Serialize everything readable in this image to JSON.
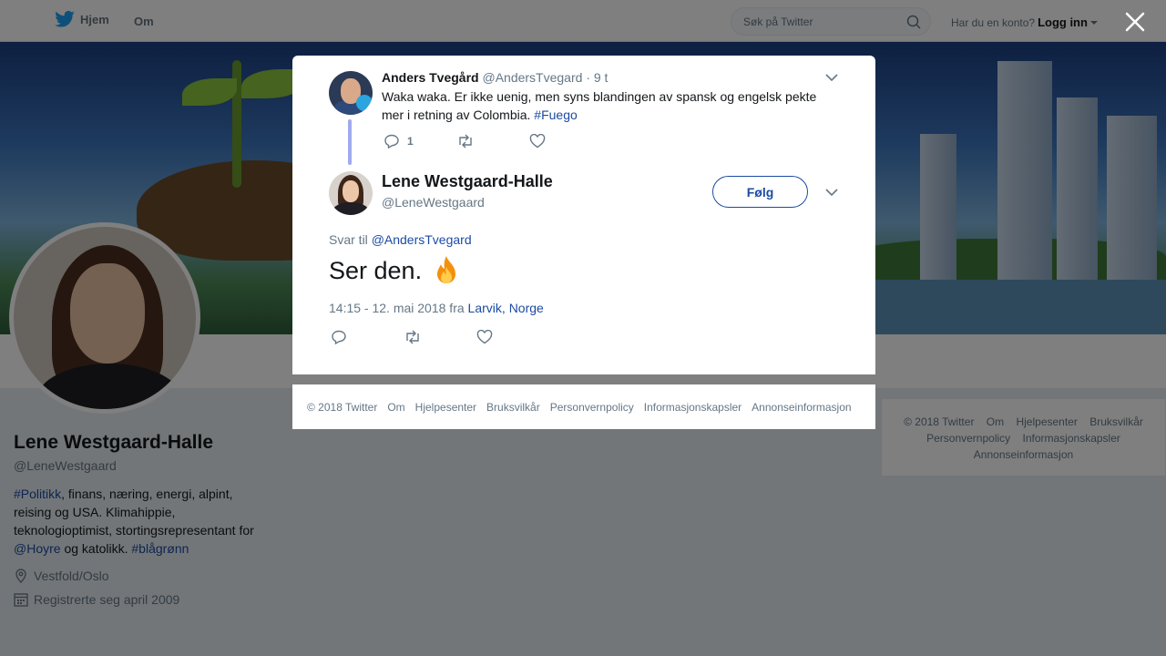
{
  "nav": {
    "home_label": "Hjem",
    "about_label": "Om",
    "search_placeholder": "Søk på Twitter",
    "account_prompt": "Har du en konto?",
    "login_label": "Logg inn"
  },
  "profile": {
    "name": "Lene Westgaard-Halle",
    "handle": "@LeneWestgaard",
    "bio": {
      "tag_politics": "#Politikk",
      "text1": ", finans, næring, energi, alpint, reising og USA. Klimahippie, teknologioptimist, stortingsrepresentant for ",
      "mention": "@Hoyre",
      "text2": " og katolikk. ",
      "tag_bluegreen": "#blågrønn"
    },
    "location": "Vestfold/Oslo",
    "joined": "Registrerte seg april 2009"
  },
  "modal": {
    "parent_tweet": {
      "name": "Anders Tvegård",
      "handle": "@AndersTvegard",
      "time": "· 9 t",
      "text": "Waka waka. Er ikke uenig, men syns blandingen av spansk og engelsk pekte mer i retning av Colombia. ",
      "hashtag": "#Fuego",
      "reply_count": "1"
    },
    "main_tweet": {
      "name": "Lene Westgaard-Halle",
      "handle": "@LeneWestgaard",
      "follow_label": "Følg",
      "reply_prefix": "Svar til ",
      "reply_mention": "@AndersTvegard",
      "text": "Ser den.",
      "timestamp": "14:15 - 12. mai 2018 fra ",
      "place_city": "Larvik",
      "place_sep": ", ",
      "place_country": "Norge"
    }
  },
  "footer": {
    "items": [
      "© 2018 Twitter",
      "Om",
      "Hjelpesenter",
      "Bruksvilkår",
      "Personvernpolicy",
      "Informasjonskapsler",
      "Annonseinformasjon"
    ]
  },
  "colors": {
    "link": "#1b4ba3",
    "twitter_blue": "#1da1f2",
    "overlay": "rgba(0,0,0,0.5)"
  }
}
